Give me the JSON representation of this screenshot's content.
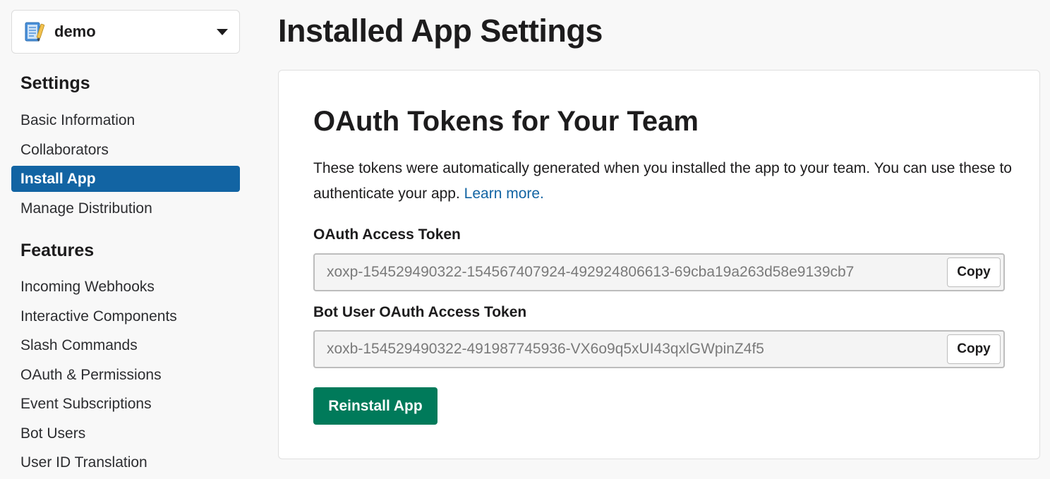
{
  "sidebar": {
    "app_name": "demo",
    "app_icon": "notebook-icon",
    "sections": [
      {
        "heading": "Settings",
        "items": [
          {
            "label": "Basic Information",
            "active": false
          },
          {
            "label": "Collaborators",
            "active": false
          },
          {
            "label": "Install App",
            "active": true
          },
          {
            "label": "Manage Distribution",
            "active": false
          }
        ]
      },
      {
        "heading": "Features",
        "items": [
          {
            "label": "Incoming Webhooks",
            "active": false
          },
          {
            "label": "Interactive Components",
            "active": false
          },
          {
            "label": "Slash Commands",
            "active": false
          },
          {
            "label": "OAuth & Permissions",
            "active": false
          },
          {
            "label": "Event Subscriptions",
            "active": false
          },
          {
            "label": "Bot Users",
            "active": false
          },
          {
            "label": "User ID Translation",
            "active": false
          }
        ]
      }
    ]
  },
  "main": {
    "page_title": "Installed App Settings",
    "card": {
      "title": "OAuth Tokens for Your Team",
      "description": "These tokens were automatically generated when you installed the app to your team. You can use these to authenticate your app.",
      "learn_more": "Learn more.",
      "fields": [
        {
          "label": "OAuth Access Token",
          "value": "xoxp-154529490322-154567407924-492924806613-69cba19a263d58e9139cb7",
          "copy_label": "Copy"
        },
        {
          "label": "Bot User OAuth Access Token",
          "value": "xoxb-154529490322-491987745936-VX6o9q5xUI43qxlGWpinZ4f5",
          "copy_label": "Copy"
        }
      ],
      "reinstall_label": "Reinstall App"
    }
  },
  "colors": {
    "active_nav": "#1264a3",
    "link": "#1264a3",
    "primary_button": "#007a5a"
  }
}
